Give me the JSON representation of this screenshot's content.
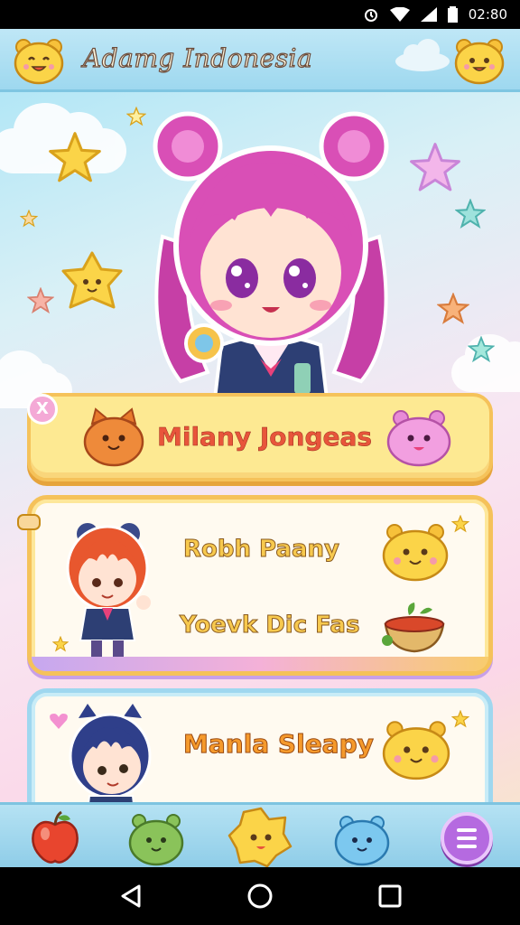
{
  "status_bar": {
    "time": "02:80"
  },
  "header": {
    "title": "Adamg Indonesia"
  },
  "cards": [
    {
      "title": "Milany Jongeas",
      "badge": "X"
    },
    {
      "line1": "Robh Paany",
      "line2": "Yoevk Dic Fas"
    },
    {
      "title": "Manla Sleapy"
    }
  ],
  "bottom_nav": {
    "items": [
      "apple-icon",
      "green-slime-icon",
      "yellow-slime-icon",
      "blue-slime-icon",
      "menu-icon"
    ]
  },
  "colors": {
    "accent": "#b56ae0",
    "card_gold": "#f5c25a",
    "header_blue": "#9ed8ef"
  }
}
